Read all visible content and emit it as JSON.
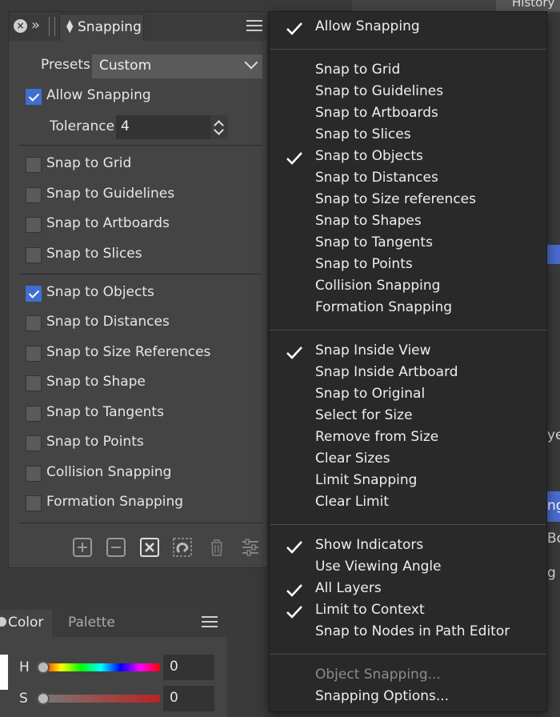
{
  "snapping_panel": {
    "tab_title": "Snapping",
    "presets_label": "Presets",
    "presets_value": "Custom",
    "allow_snapping": {
      "label": "Allow Snapping",
      "checked": true
    },
    "tolerance_label": "Tolerance",
    "tolerance_value": "4",
    "options_group1": [
      {
        "label": "Snap to Grid",
        "checked": false
      },
      {
        "label": "Snap to Guidelines",
        "checked": false
      },
      {
        "label": "Snap to Artboards",
        "checked": false
      },
      {
        "label": "Snap to Slices",
        "checked": false
      }
    ],
    "options_group2": [
      {
        "label": "Snap to Objects",
        "checked": true
      },
      {
        "label": "Snap to Distances",
        "checked": false
      },
      {
        "label": "Snap to Size References",
        "checked": false
      },
      {
        "label": "Snap to Shape",
        "checked": false
      },
      {
        "label": "Snap to Tangents",
        "checked": false
      },
      {
        "label": "Snap to Points",
        "checked": false
      },
      {
        "label": "Collision Snapping",
        "checked": false
      },
      {
        "label": "Formation Snapping",
        "checked": false
      }
    ],
    "toolbar_icons": [
      "add-preset-icon",
      "remove-preset-icon",
      "delete-box-icon",
      "magnet-icon",
      "trash-icon",
      "sliders-icon"
    ]
  },
  "color_panel": {
    "tab_color": "Color",
    "tab_palette": "Palette",
    "h_label": "H",
    "h_value": "0",
    "s_label": "S",
    "s_value": "0"
  },
  "right_panel": {
    "tab_history": "History",
    "snip1": "ye",
    "snip2": "ng",
    "snip3": "Bo",
    "snip4": "g"
  },
  "menu": {
    "section1": [
      {
        "label": "Allow Snapping",
        "checked": true
      }
    ],
    "section2": [
      {
        "label": "Snap to Grid",
        "checked": false
      },
      {
        "label": "Snap to Guidelines",
        "checked": false
      },
      {
        "label": "Snap to Artboards",
        "checked": false
      },
      {
        "label": "Snap to Slices",
        "checked": false
      },
      {
        "label": "Snap to Objects",
        "checked": true
      },
      {
        "label": "Snap to Distances",
        "checked": false
      },
      {
        "label": "Snap to Size references",
        "checked": false
      },
      {
        "label": "Snap to Shapes",
        "checked": false
      },
      {
        "label": "Snap to Tangents",
        "checked": false
      },
      {
        "label": "Snap to Points",
        "checked": false
      },
      {
        "label": "Collision Snapping",
        "checked": false
      },
      {
        "label": "Formation Snapping",
        "checked": false
      }
    ],
    "section3": [
      {
        "label": "Snap Inside View",
        "checked": true
      },
      {
        "label": "Snap Inside Artboard",
        "checked": false
      },
      {
        "label": "Snap to Original",
        "checked": false
      },
      {
        "label": "Select for Size",
        "checked": false
      },
      {
        "label": "Remove from Size",
        "checked": false
      },
      {
        "label": "Clear Sizes",
        "checked": false
      },
      {
        "label": "Limit Snapping",
        "checked": false
      },
      {
        "label": "Clear Limit",
        "checked": false
      }
    ],
    "section4": [
      {
        "label": "Show Indicators",
        "checked": true
      },
      {
        "label": "Use Viewing Angle",
        "checked": false
      },
      {
        "label": "All Layers",
        "checked": true
      },
      {
        "label": "Limit to Context",
        "checked": true
      },
      {
        "label": "Snap to Nodes in Path Editor",
        "checked": false
      }
    ],
    "section5": [
      {
        "label": "Object Snapping...",
        "disabled": true
      },
      {
        "label": "Snapping Options...",
        "disabled": false
      }
    ]
  }
}
